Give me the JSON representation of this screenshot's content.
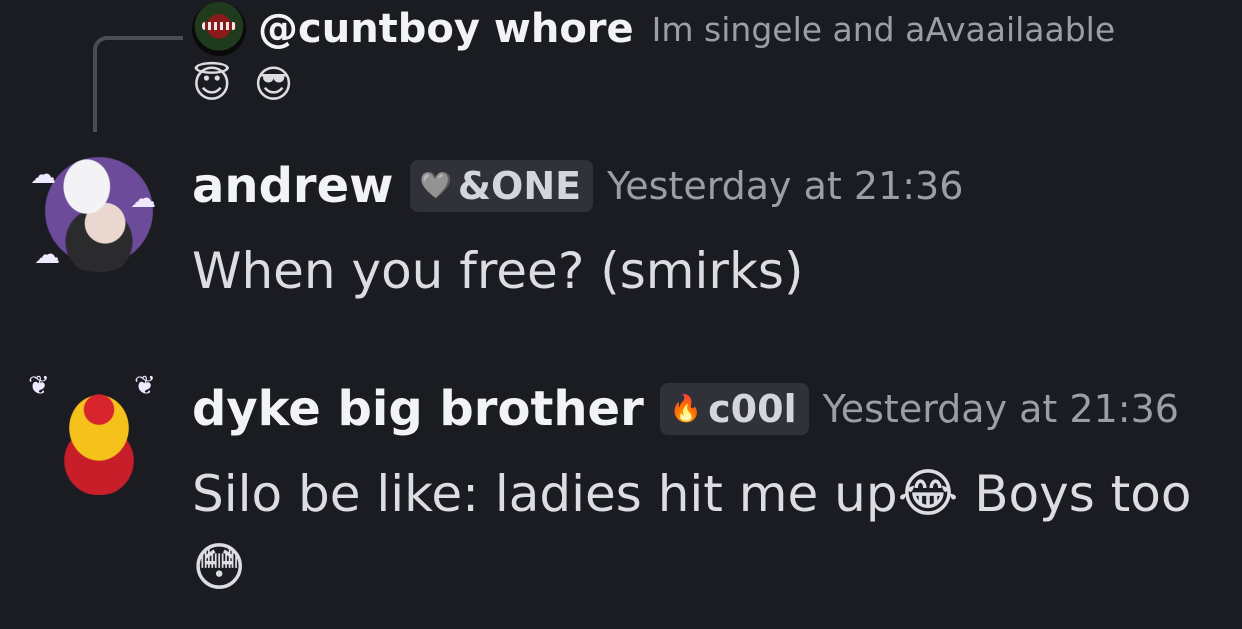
{
  "reply": {
    "author": "@cuntboy whore",
    "text": "Im singele and aAvaailaable",
    "emojis": [
      "😇",
      "😎"
    ]
  },
  "messages": [
    {
      "author": "andrew",
      "tag_icon": "🩶",
      "tag_label": "&ONE",
      "timestamp": "Yesterday at 21:36",
      "text": "When you free? (smirks)"
    },
    {
      "author": "dyke big brother",
      "tag_icon": "🔥",
      "tag_label": "c00l",
      "timestamp": "Yesterday at 21:36",
      "text_part1": "Silo be like: ladies hit me up",
      "emoji1": "😂",
      "text_part2": " Boys too",
      "emoji2": "😳"
    }
  ]
}
